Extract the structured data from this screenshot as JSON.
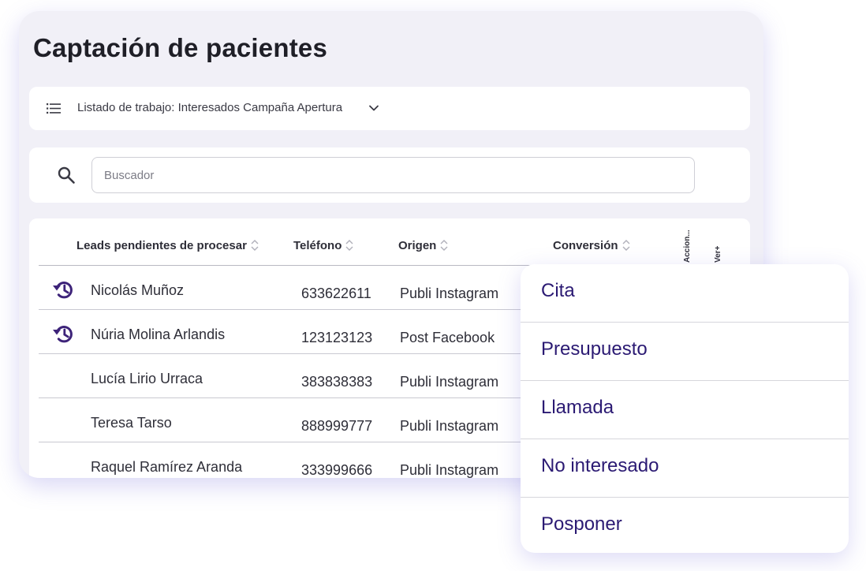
{
  "page": {
    "title": "Captación de pacientes"
  },
  "worklist": {
    "label": "Listado de trabajo: Interesados Campaña Apertura"
  },
  "search": {
    "placeholder": "Buscador"
  },
  "table": {
    "headers": {
      "lead": "Leads pendientes de procesar",
      "phone": "Teléfono",
      "origin": "Origen",
      "conversion": "Conversión",
      "actions": "Accion...",
      "more": "Ver+"
    },
    "rows": [
      {
        "name": "Nicolás Muñoz",
        "phone": "633622611",
        "origin": "Publi Instagram",
        "history": true
      },
      {
        "name": "Núria Molina Arlandis",
        "phone": "123123123",
        "origin": "Post Facebook",
        "history": true
      },
      {
        "name": "Lucía Lirio Urraca",
        "phone": "383838383",
        "origin": "Publi Instagram",
        "history": false
      },
      {
        "name": "Teresa Tarso",
        "phone": "888999777",
        "origin": "Publi Instagram",
        "history": false
      },
      {
        "name": "Raquel Ramírez Aranda",
        "phone": "333999666",
        "origin": "Publi Instagram",
        "history": false
      }
    ]
  },
  "menu": {
    "items": [
      {
        "label": "Cita"
      },
      {
        "label": "Presupuesto"
      },
      {
        "label": "Llamada"
      },
      {
        "label": "No interesado"
      },
      {
        "label": "Posponer"
      }
    ]
  },
  "colors": {
    "accent": "#2b1a73",
    "icon": "#3d2379",
    "card_bg": "#f1f0f7",
    "shadow": "#786edc"
  },
  "icons": {
    "worklist": "list-icon",
    "worklist_toggle": "chevron-down-icon",
    "search": "search-icon",
    "history": "history-icon",
    "sort": "sort-icon"
  }
}
